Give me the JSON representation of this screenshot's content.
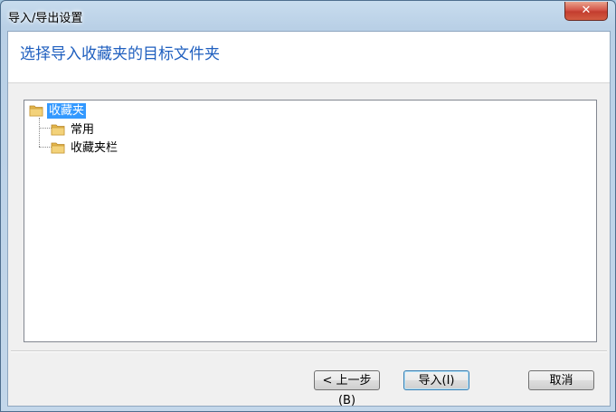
{
  "window": {
    "title": "导入/导出设置",
    "close_glyph": "✕"
  },
  "header": {
    "instruction": "选择导入收藏夹的目标文件夹"
  },
  "tree": {
    "root": {
      "label": "收藏夹",
      "selected": true
    },
    "children": [
      {
        "label": "常用"
      },
      {
        "label": "收藏夹栏"
      }
    ]
  },
  "buttons": {
    "back_label": "< 上一步(B)",
    "import_label": "导入(I)",
    "cancel_label": "取消"
  },
  "icons": {
    "folder": "folder-icon",
    "close": "close-icon"
  },
  "colors": {
    "header_text": "#1f5fbf",
    "selection": "#3399ff",
    "close_button": "#c33d2f",
    "folder": "#e8c25a"
  }
}
